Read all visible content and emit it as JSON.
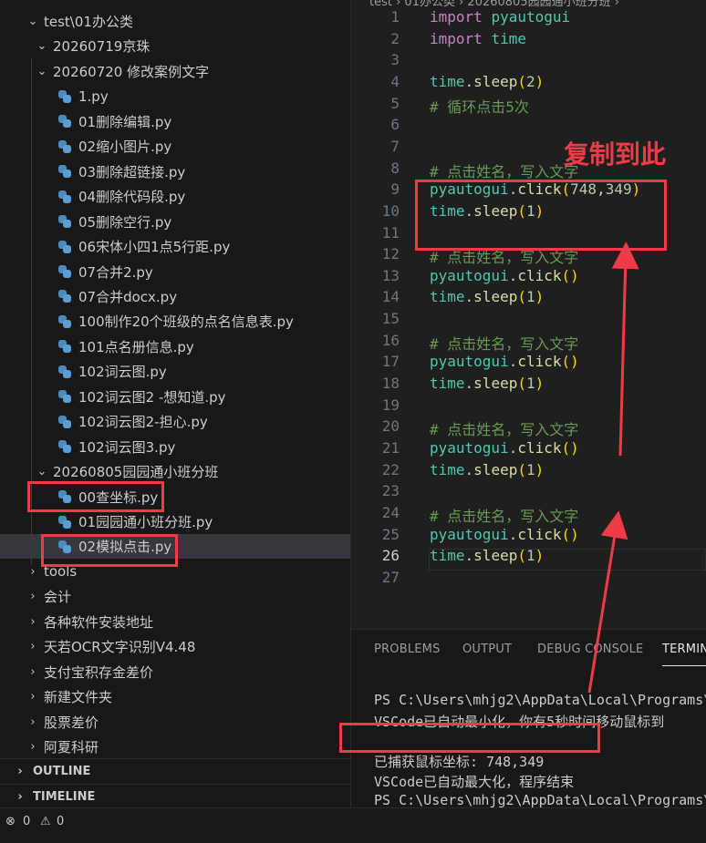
{
  "explorer": {
    "tree": [
      {
        "label": "test\\01办公类",
        "type": "folder",
        "expanded": true,
        "depth": 0
      },
      {
        "label": "20260719京珠",
        "type": "folder",
        "expanded": true,
        "depth": 1
      },
      {
        "label": "20260720 修改案例文字",
        "type": "folder",
        "expanded": true,
        "depth": 1
      },
      {
        "label": "1.py",
        "type": "py",
        "depth": 2
      },
      {
        "label": "01删除编辑.py",
        "type": "py",
        "depth": 2
      },
      {
        "label": "02缩小图片.py",
        "type": "py",
        "depth": 2
      },
      {
        "label": "03删除超链接.py",
        "type": "py",
        "depth": 2
      },
      {
        "label": "04删除代码段.py",
        "type": "py",
        "depth": 2
      },
      {
        "label": "05删除空行.py",
        "type": "py",
        "depth": 2
      },
      {
        "label": "06宋体小四1点5行距.py",
        "type": "py",
        "depth": 2
      },
      {
        "label": "07合并2.py",
        "type": "py",
        "depth": 2
      },
      {
        "label": "07合并docx.py",
        "type": "py",
        "depth": 2
      },
      {
        "label": "100制作20个班级的点名信息表.py",
        "type": "py",
        "depth": 2
      },
      {
        "label": "101点名册信息.py",
        "type": "py",
        "depth": 2
      },
      {
        "label": "102词云图.py",
        "type": "py",
        "depth": 2
      },
      {
        "label": "102词云图2 -想知道.py",
        "type": "py",
        "depth": 2
      },
      {
        "label": "102词云图2-担心.py",
        "type": "py",
        "depth": 2
      },
      {
        "label": "102词云图3.py",
        "type": "py",
        "depth": 2
      },
      {
        "label": "20260805园园通小班分班",
        "type": "folder",
        "expanded": true,
        "depth": 1
      },
      {
        "label": "00查坐标.py",
        "type": "py",
        "depth": 2
      },
      {
        "label": "01园园通小班分班.py",
        "type": "py",
        "depth": 2
      },
      {
        "label": "02模拟点击.py",
        "type": "py",
        "depth": 2,
        "selected": true
      },
      {
        "label": "tools",
        "type": "folder",
        "expanded": false,
        "depth": 0
      },
      {
        "label": "会计",
        "type": "folder",
        "expanded": false,
        "depth": 0
      },
      {
        "label": "各种软件安装地址",
        "type": "folder",
        "expanded": false,
        "depth": 0
      },
      {
        "label": "天若OCR文字识别V4.48",
        "type": "folder",
        "expanded": false,
        "depth": 0
      },
      {
        "label": "支付宝积存金差价",
        "type": "folder",
        "expanded": false,
        "depth": 0
      },
      {
        "label": "新建文件夹",
        "type": "folder",
        "expanded": false,
        "depth": 0
      },
      {
        "label": "股票差价",
        "type": "folder",
        "expanded": false,
        "depth": 0
      },
      {
        "label": "阿夏科研",
        "type": "folder",
        "expanded": false,
        "depth": 0
      }
    ],
    "outline_label": "OUTLINE",
    "timeline_label": "TIMELINE"
  },
  "editor": {
    "breadcrumb": "test › 01办公类 › 20260805园园通小班分班 › ",
    "current_line": 26,
    "lines": [
      [
        [
          "kw",
          "import"
        ],
        [
          "p",
          " "
        ],
        [
          "mod",
          "pyautogui"
        ]
      ],
      [
        [
          "kw",
          "import"
        ],
        [
          "p",
          " "
        ],
        [
          "mod",
          "time"
        ]
      ],
      [],
      [
        [
          "mod",
          "time"
        ],
        [
          "p",
          "."
        ],
        [
          "fn",
          "sleep"
        ],
        [
          "br1",
          "("
        ],
        [
          "num",
          "2"
        ],
        [
          "br1",
          ")"
        ]
      ],
      [
        [
          "cm",
          "# 循环点击5次"
        ]
      ],
      [],
      [],
      [
        [
          "cm",
          "# 点击姓名，写入文字"
        ]
      ],
      [
        [
          "mod",
          "pyautogui"
        ],
        [
          "p",
          "."
        ],
        [
          "fn",
          "click"
        ],
        [
          "br1",
          "("
        ],
        [
          "num",
          "748"
        ],
        [
          "p",
          ","
        ],
        [
          "num",
          "349"
        ],
        [
          "br1",
          ")"
        ]
      ],
      [
        [
          "mod",
          "time"
        ],
        [
          "p",
          "."
        ],
        [
          "fn",
          "sleep"
        ],
        [
          "br1",
          "("
        ],
        [
          "num",
          "1"
        ],
        [
          "br1",
          ")"
        ]
      ],
      [],
      [
        [
          "cm",
          "# 点击姓名，写入文字"
        ]
      ],
      [
        [
          "mod",
          "pyautogui"
        ],
        [
          "p",
          "."
        ],
        [
          "fn",
          "click"
        ],
        [
          "br1",
          "()"
        ]
      ],
      [
        [
          "mod",
          "time"
        ],
        [
          "p",
          "."
        ],
        [
          "fn",
          "sleep"
        ],
        [
          "br1",
          "("
        ],
        [
          "num",
          "1"
        ],
        [
          "br1",
          ")"
        ]
      ],
      [],
      [
        [
          "cm",
          "# 点击姓名，写入文字"
        ]
      ],
      [
        [
          "mod",
          "pyautogui"
        ],
        [
          "p",
          "."
        ],
        [
          "fn",
          "click"
        ],
        [
          "br1",
          "()"
        ]
      ],
      [
        [
          "mod",
          "time"
        ],
        [
          "p",
          "."
        ],
        [
          "fn",
          "sleep"
        ],
        [
          "br1",
          "("
        ],
        [
          "num",
          "1"
        ],
        [
          "br1",
          ")"
        ]
      ],
      [],
      [
        [
          "cm",
          "# 点击姓名，写入文字"
        ]
      ],
      [
        [
          "mod",
          "pyautogui"
        ],
        [
          "p",
          "."
        ],
        [
          "fn",
          "click"
        ],
        [
          "br1",
          "()"
        ]
      ],
      [
        [
          "mod",
          "time"
        ],
        [
          "p",
          "."
        ],
        [
          "fn",
          "sleep"
        ],
        [
          "br1",
          "("
        ],
        [
          "num",
          "1"
        ],
        [
          "br1",
          ")"
        ]
      ],
      [],
      [
        [
          "cm",
          "# 点击姓名，写入文字"
        ]
      ],
      [
        [
          "mod",
          "pyautogui"
        ],
        [
          "p",
          "."
        ],
        [
          "fn",
          "click"
        ],
        [
          "br1",
          "()"
        ]
      ],
      [
        [
          "mod",
          "time"
        ],
        [
          "p",
          "."
        ],
        [
          "fn",
          "sleep"
        ],
        [
          "br1",
          "("
        ],
        [
          "num",
          "1"
        ],
        [
          "br1",
          ")"
        ]
      ],
      []
    ]
  },
  "panel": {
    "tabs": [
      "PROBLEMS",
      "OUTPUT",
      "DEBUG CONSOLE",
      "TERMINAL"
    ],
    "active_tab": "TERMINAL",
    "terminal_lines": [
      "PS C:\\Users\\mhjg2\\AppData\\Local\\Programs\\",
      "VSCode已自动最小化，你有5秒时间移动鼠标到",
      "",
      "已捕获鼠标坐标: 748,349",
      "VSCode已自动最大化，程序结束",
      "PS C:\\Users\\mhjg2\\AppData\\Local\\Programs\\"
    ]
  },
  "statusbar": {
    "errors": "0",
    "warnings": "0"
  },
  "annotation": {
    "text": "复制到此",
    "color": "#ef3b47"
  }
}
